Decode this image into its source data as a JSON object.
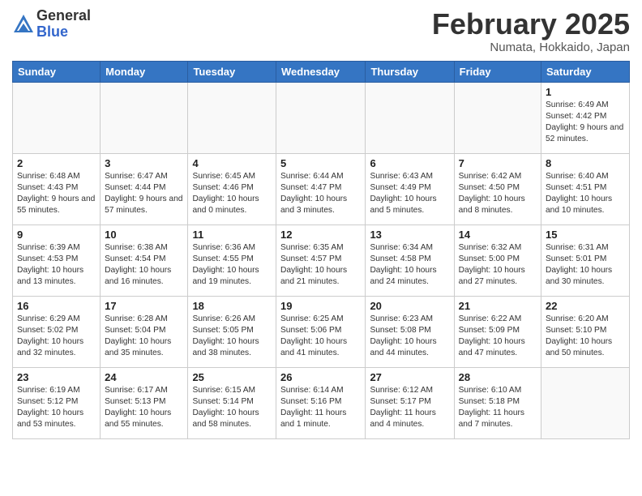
{
  "header": {
    "logo_general": "General",
    "logo_blue": "Blue",
    "month_title": "February 2025",
    "location": "Numata, Hokkaido, Japan"
  },
  "days_of_week": [
    "Sunday",
    "Monday",
    "Tuesday",
    "Wednesday",
    "Thursday",
    "Friday",
    "Saturday"
  ],
  "weeks": [
    [
      {
        "day": "",
        "info": ""
      },
      {
        "day": "",
        "info": ""
      },
      {
        "day": "",
        "info": ""
      },
      {
        "day": "",
        "info": ""
      },
      {
        "day": "",
        "info": ""
      },
      {
        "day": "",
        "info": ""
      },
      {
        "day": "1",
        "info": "Sunrise: 6:49 AM\nSunset: 4:42 PM\nDaylight: 9 hours and 52 minutes."
      }
    ],
    [
      {
        "day": "2",
        "info": "Sunrise: 6:48 AM\nSunset: 4:43 PM\nDaylight: 9 hours and 55 minutes."
      },
      {
        "day": "3",
        "info": "Sunrise: 6:47 AM\nSunset: 4:44 PM\nDaylight: 9 hours and 57 minutes."
      },
      {
        "day": "4",
        "info": "Sunrise: 6:45 AM\nSunset: 4:46 PM\nDaylight: 10 hours and 0 minutes."
      },
      {
        "day": "5",
        "info": "Sunrise: 6:44 AM\nSunset: 4:47 PM\nDaylight: 10 hours and 3 minutes."
      },
      {
        "day": "6",
        "info": "Sunrise: 6:43 AM\nSunset: 4:49 PM\nDaylight: 10 hours and 5 minutes."
      },
      {
        "day": "7",
        "info": "Sunrise: 6:42 AM\nSunset: 4:50 PM\nDaylight: 10 hours and 8 minutes."
      },
      {
        "day": "8",
        "info": "Sunrise: 6:40 AM\nSunset: 4:51 PM\nDaylight: 10 hours and 10 minutes."
      }
    ],
    [
      {
        "day": "9",
        "info": "Sunrise: 6:39 AM\nSunset: 4:53 PM\nDaylight: 10 hours and 13 minutes."
      },
      {
        "day": "10",
        "info": "Sunrise: 6:38 AM\nSunset: 4:54 PM\nDaylight: 10 hours and 16 minutes."
      },
      {
        "day": "11",
        "info": "Sunrise: 6:36 AM\nSunset: 4:55 PM\nDaylight: 10 hours and 19 minutes."
      },
      {
        "day": "12",
        "info": "Sunrise: 6:35 AM\nSunset: 4:57 PM\nDaylight: 10 hours and 21 minutes."
      },
      {
        "day": "13",
        "info": "Sunrise: 6:34 AM\nSunset: 4:58 PM\nDaylight: 10 hours and 24 minutes."
      },
      {
        "day": "14",
        "info": "Sunrise: 6:32 AM\nSunset: 5:00 PM\nDaylight: 10 hours and 27 minutes."
      },
      {
        "day": "15",
        "info": "Sunrise: 6:31 AM\nSunset: 5:01 PM\nDaylight: 10 hours and 30 minutes."
      }
    ],
    [
      {
        "day": "16",
        "info": "Sunrise: 6:29 AM\nSunset: 5:02 PM\nDaylight: 10 hours and 32 minutes."
      },
      {
        "day": "17",
        "info": "Sunrise: 6:28 AM\nSunset: 5:04 PM\nDaylight: 10 hours and 35 minutes."
      },
      {
        "day": "18",
        "info": "Sunrise: 6:26 AM\nSunset: 5:05 PM\nDaylight: 10 hours and 38 minutes."
      },
      {
        "day": "19",
        "info": "Sunrise: 6:25 AM\nSunset: 5:06 PM\nDaylight: 10 hours and 41 minutes."
      },
      {
        "day": "20",
        "info": "Sunrise: 6:23 AM\nSunset: 5:08 PM\nDaylight: 10 hours and 44 minutes."
      },
      {
        "day": "21",
        "info": "Sunrise: 6:22 AM\nSunset: 5:09 PM\nDaylight: 10 hours and 47 minutes."
      },
      {
        "day": "22",
        "info": "Sunrise: 6:20 AM\nSunset: 5:10 PM\nDaylight: 10 hours and 50 minutes."
      }
    ],
    [
      {
        "day": "23",
        "info": "Sunrise: 6:19 AM\nSunset: 5:12 PM\nDaylight: 10 hours and 53 minutes."
      },
      {
        "day": "24",
        "info": "Sunrise: 6:17 AM\nSunset: 5:13 PM\nDaylight: 10 hours and 55 minutes."
      },
      {
        "day": "25",
        "info": "Sunrise: 6:15 AM\nSunset: 5:14 PM\nDaylight: 10 hours and 58 minutes."
      },
      {
        "day": "26",
        "info": "Sunrise: 6:14 AM\nSunset: 5:16 PM\nDaylight: 11 hours and 1 minute."
      },
      {
        "day": "27",
        "info": "Sunrise: 6:12 AM\nSunset: 5:17 PM\nDaylight: 11 hours and 4 minutes."
      },
      {
        "day": "28",
        "info": "Sunrise: 6:10 AM\nSunset: 5:18 PM\nDaylight: 11 hours and 7 minutes."
      },
      {
        "day": "",
        "info": ""
      }
    ]
  ]
}
